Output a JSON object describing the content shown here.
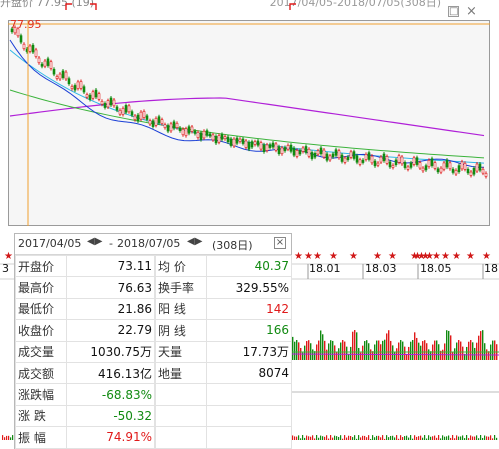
{
  "window": {
    "title": "开盘价 77.95 (19)",
    "date_range": "2017/04/05-2018/07/05(308日)",
    "maximize_icon": "window-maximize-icon",
    "close_icon": "window-close-icon"
  },
  "price_marker": "77.95",
  "axis": {
    "left_tick": "3",
    "ticks": [
      "18.01",
      "18.03",
      "18.05",
      "18."
    ]
  },
  "panel": {
    "start_date": "2017/04/05",
    "end_date": "2018/07/05",
    "separator": "-",
    "days": "(308日)",
    "arrow_icon": "left-right-arrow-icon",
    "close_icon": "close-icon",
    "left_rows": [
      {
        "label": "开盘价",
        "value": "73.11",
        "color": "dark"
      },
      {
        "label": "最高价",
        "value": "76.63",
        "color": "dark"
      },
      {
        "label": "最低价",
        "value": "21.86",
        "color": "dark"
      },
      {
        "label": "收盘价",
        "value": "22.79",
        "color": "dark"
      },
      {
        "label": "成交量",
        "value": "1030.75万",
        "color": "dark"
      },
      {
        "label": "成交额",
        "value": "416.13亿",
        "color": "dark"
      },
      {
        "label": "涨跌幅",
        "value": "-68.83%",
        "color": "green"
      },
      {
        "label": "涨  跌",
        "value": "-50.32",
        "color": "green"
      },
      {
        "label": "振  幅",
        "value": "74.91%",
        "color": "red"
      }
    ],
    "right_rows": [
      {
        "label": "均  价",
        "value": "40.37",
        "color": "green"
      },
      {
        "label": "换手率",
        "value": "329.55%",
        "color": "dark"
      },
      {
        "label": "阳  线",
        "value": "142",
        "color": "red"
      },
      {
        "label": "阴  线",
        "value": "166",
        "color": "green"
      },
      {
        "label": "天量",
        "value": "17.73万",
        "color": "dark"
      },
      {
        "label": "地量",
        "value": "8074",
        "color": "dark"
      }
    ]
  },
  "colors": {
    "up": "#e01a1a",
    "down": "#118a11",
    "ma5": "#1a3fd6",
    "ma10": "#31b7e6",
    "ma20": "#3cb33c",
    "ma60": "#b020d8",
    "cursor": "#f0a030"
  }
}
